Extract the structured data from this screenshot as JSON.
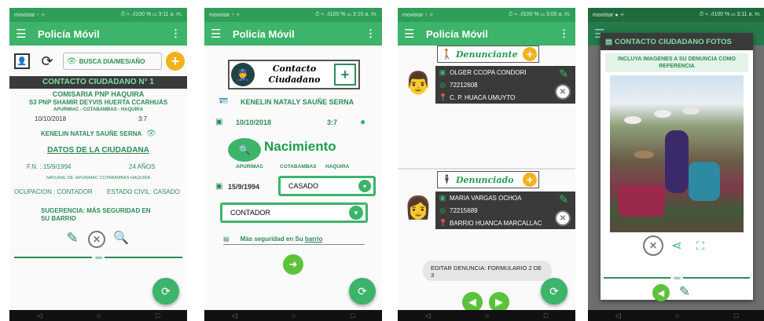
{
  "status_bars": [
    {
      "left": "movistar ↑ ✧",
      "right": "⏱ ≈ .ıl100 % ▭ 3:11 a. m."
    },
    {
      "left": "movistar ↑ ✧",
      "right": "⏱ ≈ .ıl100 % ▭ 3:10 a. m."
    },
    {
      "left": "movistar ↑ ✧",
      "right": "⏱ ≈ .ıl100 % ▭ 3:00 a. m."
    },
    {
      "left": "movistar ● ✧",
      "right": "⏱ ≈ .ıl100 % ▭ 3:11 a. m."
    }
  ],
  "app_title": "Policía Móvil",
  "s1": {
    "search_label": "BUSCA DIA/MES/AÑO",
    "header": "CONTACTO CIUDADANO N° 1",
    "comisaria": "COMISARIA PNP HAQUIRA",
    "officer": "S3 PNP SHAMIR DEYVIS HUERTA CCARHUAS",
    "location": "APURIMAC - COTABAMBAS - HAQUIRA",
    "date": "10/10/2018",
    "time": "3:7",
    "citizen": "KENELIN NATALY SAUÑE SERNA",
    "datos_title": "DATOS DE LA CIUDADANA",
    "fn": "F.N. : 15/9/1994",
    "age": "24 AÑOS",
    "natural": "NATURAL DE: APURIMAC COTABAMBAS HAQUIRA",
    "ocupacion": "OCUPACION : CONTADOR",
    "estado": "ESTADO CIVIL: CASADO",
    "sugerencia": "SUGERENCIA: MÁS SEGURIDAD EN SU BARRIO"
  },
  "s2": {
    "logo_line1": "Contacto",
    "logo_line2": "Ciudadano",
    "name": "KENELIN NATALY SAUÑE SERNA",
    "date": "10/10/2018",
    "time": "3:7",
    "nacimiento": "Nacimiento",
    "place1": "APURIMAC",
    "place2": "COTABAMBAS",
    "place3": "HAQUIRA",
    "birth_date": "15/9/1994",
    "estado_value": "CASADO",
    "ocupacion_value": "CONTADOR",
    "sugerencia_prefix": "Más seguridad en Su ",
    "sugerencia_underlined": "barrio"
  },
  "s3": {
    "denunciante_title": "Denunciante",
    "d1_name": "OLGER CCOPA CONDORI",
    "d1_phone": "72212608",
    "d1_addr": "C. P. HUACA UMUYTO",
    "denunciado_title": "Denunciado",
    "d2_name": "MARIA VARGAS OCHOA",
    "d2_phone": "72215689",
    "d2_addr": "BARRIO HUANCA MARCALLAC",
    "toast": "EDITAR DENUNCIA: FORMULARIO 2 DE 3"
  },
  "s4": {
    "dialog_title": "CONTACTO CIUDADANO FOTOS",
    "instruction": "INCLUYA IMAGENES A SU DENUNCIA COMO REFERENCIA"
  }
}
